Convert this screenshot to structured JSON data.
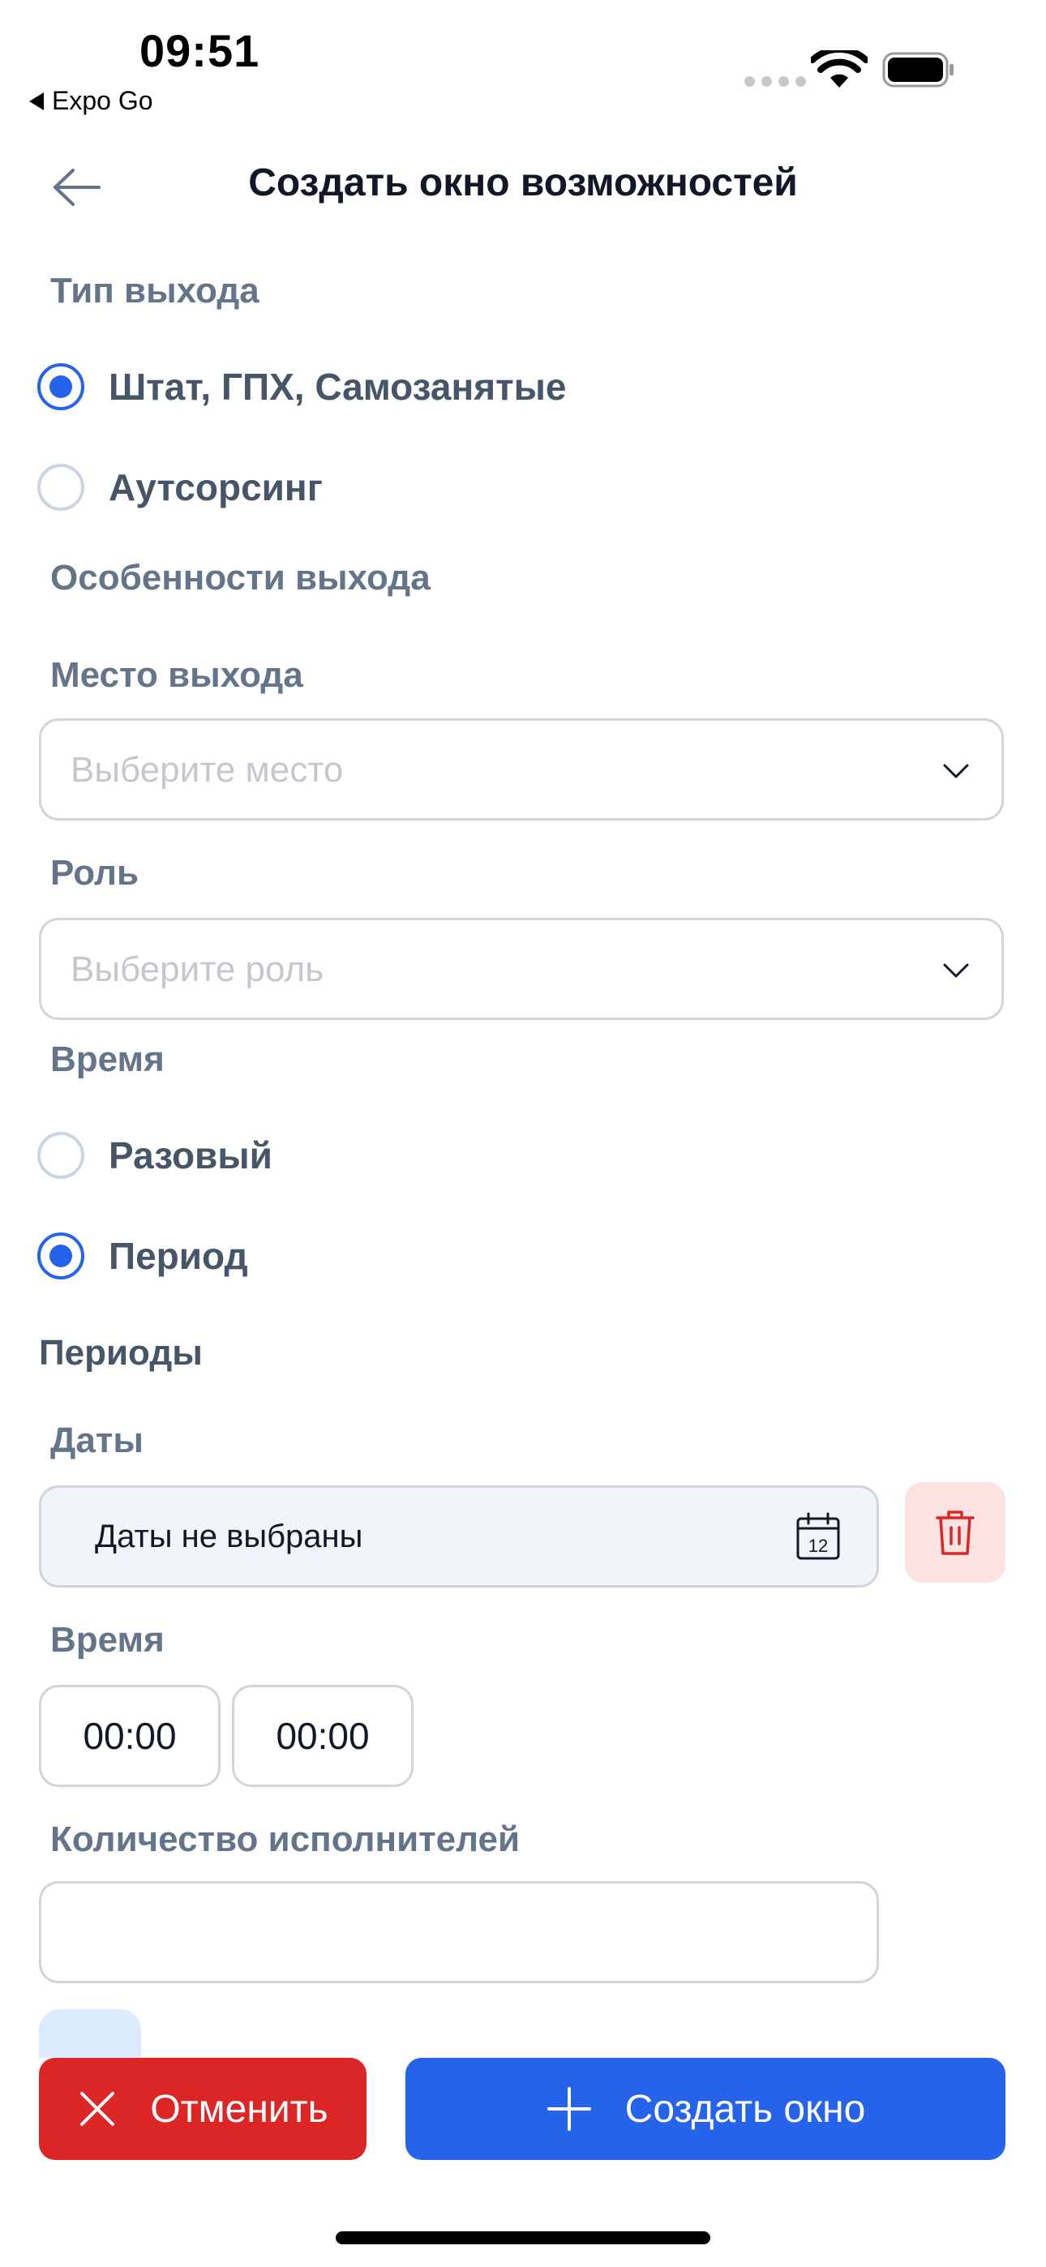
{
  "status_bar": {
    "time": "09:51",
    "back_app_label": "Expo Go"
  },
  "header": {
    "title": "Создать окно возможностей"
  },
  "exit_type": {
    "label": "Тип выхода",
    "options": [
      {
        "label": "Штат, ГПХ, Самозанятые",
        "selected": true
      },
      {
        "label": "Аутсорсинг",
        "selected": false
      }
    ]
  },
  "exit_features": {
    "label": "Особенности выхода"
  },
  "place": {
    "label": "Место выхода",
    "placeholder": "Выберите место"
  },
  "role": {
    "label": "Роль",
    "placeholder": "Выберите роль"
  },
  "time_mode": {
    "label": "Время",
    "options": [
      {
        "label": "Разовый",
        "selected": false
      },
      {
        "label": "Период",
        "selected": true
      }
    ]
  },
  "periods": {
    "title": "Периоды",
    "dates_label": "Даты",
    "dates_value": "Даты не выбраны",
    "calendar_day": "12",
    "time_label": "Время",
    "time_from": "00:00",
    "time_to": "00:00",
    "performers_label": "Количество исполнителей",
    "performers_value": ""
  },
  "actions": {
    "cancel_label": "Отменить",
    "create_label": "Создать окно"
  },
  "colors": {
    "primary": "#2563eb",
    "danger": "#dc2626",
    "danger_soft": "#fde2e2"
  }
}
